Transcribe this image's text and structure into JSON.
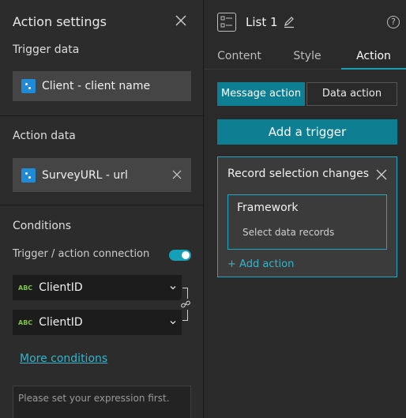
{
  "left_panel": {
    "title": "Action settings",
    "trigger_data": {
      "heading": "Trigger data",
      "field_text": "Client - client name"
    },
    "action_data": {
      "heading": "Action data",
      "field_text": "SurveyURL - url"
    },
    "conditions": {
      "heading": "Conditions",
      "connection_label": "Trigger / action connection",
      "connection_enabled": true,
      "trigger_field": {
        "type_badge": "ABC",
        "value": "ClientID"
      },
      "action_field": {
        "type_badge": "ABC",
        "value": "ClientID"
      },
      "more_conditions": "More conditions",
      "expression_placeholder": "Please set your expression first."
    }
  },
  "right_panel": {
    "widget_title": "List 1",
    "help_glyph": "?",
    "tabs": [
      {
        "label": "Content",
        "active": false
      },
      {
        "label": "Style",
        "active": false
      },
      {
        "label": "Action",
        "active": true
      }
    ],
    "action_types": [
      {
        "label": "Message action",
        "active": true
      },
      {
        "label": "Data action",
        "active": false
      }
    ],
    "add_trigger_label": "Add a trigger",
    "trigger": {
      "title": "Record selection changes",
      "framework_title": "Framework",
      "framework_sub": "Select data records",
      "add_action": "+ Add action"
    }
  },
  "colors": {
    "accent": "#0e7f93",
    "accent_border": "#21a7bf",
    "link": "#34b4cc",
    "toggle_on": "#15a0b8",
    "datasource_icon": "#1f8ad6",
    "string_badge": "#7fc24a"
  },
  "icons": [
    "close-icon",
    "datasource-icon",
    "chevron-down-icon",
    "link-icon",
    "list-widget-icon",
    "pencil-icon",
    "help-icon"
  ]
}
